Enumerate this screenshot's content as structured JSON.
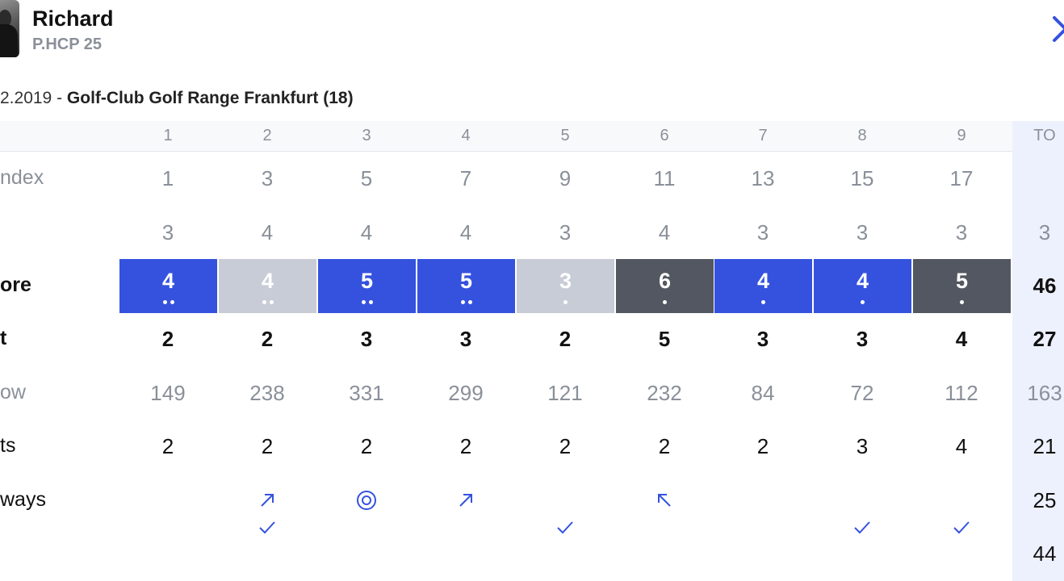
{
  "player": {
    "name": "Richard",
    "hcp": "P.HCP 25"
  },
  "round": {
    "date": "2.2019 - ",
    "course": "Golf-Club Golf Range Frankfurt (18)"
  },
  "holes": [
    "1",
    "2",
    "3",
    "4",
    "5",
    "6",
    "7",
    "8",
    "9"
  ],
  "total_header": "TO",
  "rows": {
    "index": {
      "label": "ndex",
      "values": [
        "1",
        "3",
        "5",
        "7",
        "9",
        "11",
        "13",
        "15",
        "17"
      ],
      "total": ""
    },
    "par": {
      "label": "",
      "values": [
        "3",
        "4",
        "4",
        "4",
        "3",
        "4",
        "3",
        "3",
        "3"
      ],
      "total": "3"
    },
    "score": {
      "label": "ore",
      "values": [
        "4",
        "4",
        "5",
        "5",
        "3",
        "6",
        "4",
        "4",
        "5"
      ],
      "styles": [
        "blue",
        "light",
        "blue",
        "blue",
        "light",
        "dark",
        "blue",
        "blue",
        "dark"
      ],
      "dots": [
        2,
        2,
        2,
        2,
        1,
        1,
        1,
        1,
        1
      ],
      "total": "46"
    },
    "points": {
      "label": "t",
      "values": [
        "2",
        "2",
        "3",
        "3",
        "2",
        "5",
        "3",
        "3",
        "4"
      ],
      "total": "27"
    },
    "show": {
      "label": "ow",
      "values": [
        "149",
        "238",
        "331",
        "299",
        "121",
        "232",
        "84",
        "72",
        "112"
      ],
      "total": "163"
    },
    "putts": {
      "label": "ts",
      "values": [
        "2",
        "2",
        "2",
        "2",
        "2",
        "2",
        "2",
        "3",
        "4"
      ],
      "total": "21"
    },
    "fairways": {
      "label": "ways",
      "icons": [
        "",
        "arrow-up-right-icon",
        "target-icon",
        "arrow-up-right-icon",
        "",
        "arrow-up-left-icon",
        "",
        "",
        ""
      ],
      "total": "25"
    },
    "greens": {
      "icons": [
        "",
        "check-icon",
        "",
        "",
        "check-icon",
        "",
        "",
        "check-icon",
        "check-icon"
      ],
      "total": "44"
    }
  },
  "colors": {
    "accent": "#3552de",
    "light": "#c8ccd6",
    "dark": "#525761",
    "muted": "#8a9099",
    "total_bg": "#edf1fd"
  }
}
